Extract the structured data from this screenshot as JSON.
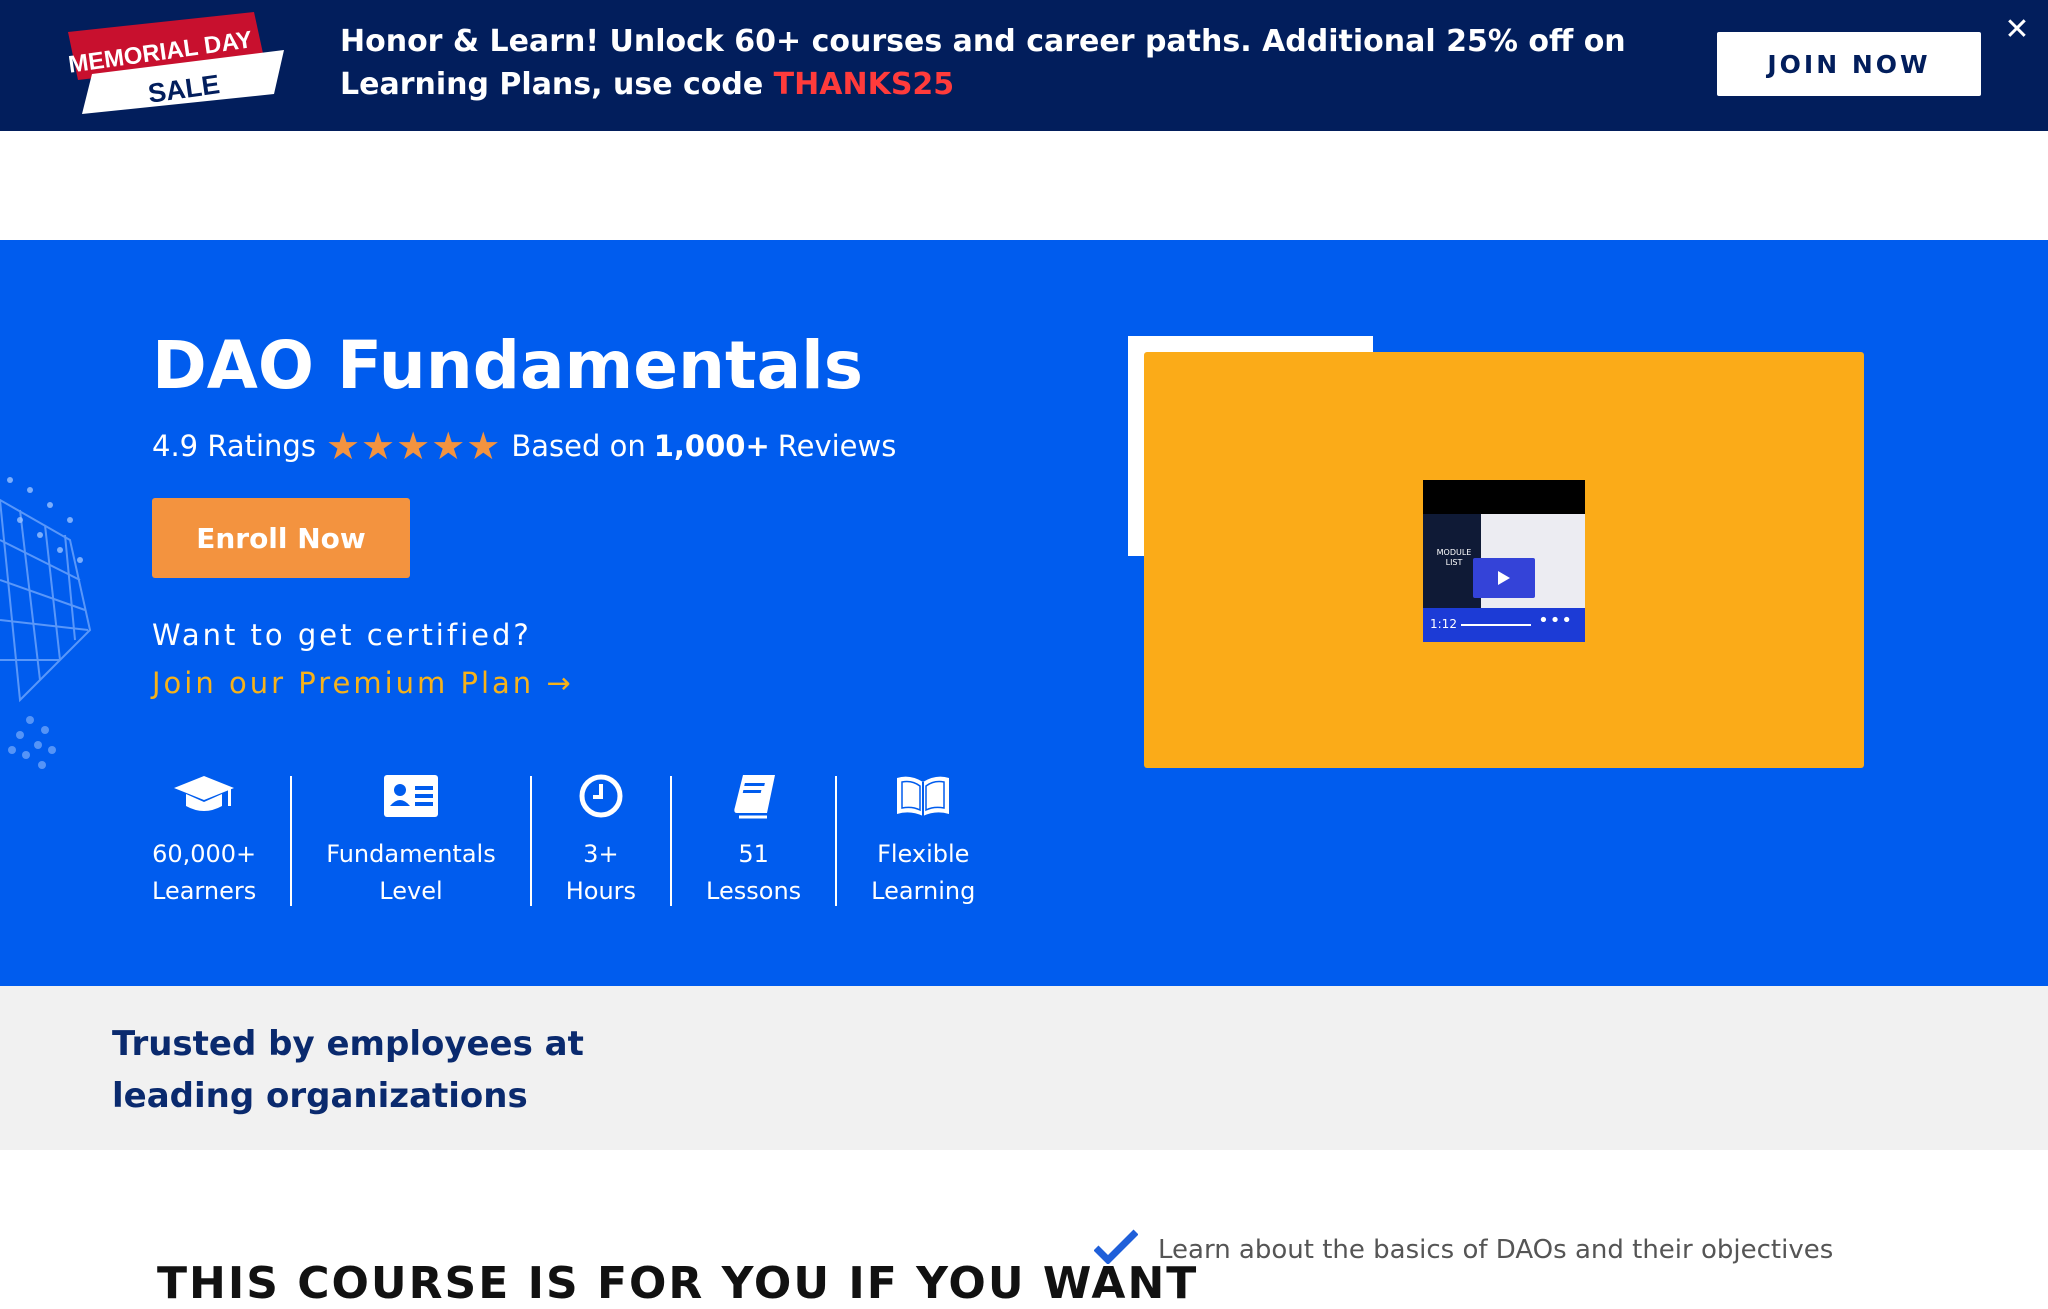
{
  "promo": {
    "badge_line1": "MEMORIAL DAY",
    "badge_line2": "SALE",
    "text": "Honor & Learn! Unlock 60+ courses and career paths. Additional 25% off on Learning Plans, use code",
    "code": "THANKS25",
    "join_label": "JOIN NOW",
    "close_glyph": "✕"
  },
  "hero": {
    "title": "DAO Fundamentals",
    "rating_value": "4.9 Ratings",
    "rating_stars": 5,
    "reviews_prefix": "Based on",
    "reviews_count": "1,000+",
    "reviews_suffix": "Reviews",
    "enroll_label": "Enroll Now",
    "cert_question": "Want to get certified?",
    "premium_link": "Join our Premium Plan →",
    "stats": [
      {
        "line1": "60,000+",
        "line2": "Learners",
        "icon": "graduation-cap-icon"
      },
      {
        "line1": "Fundamentals",
        "line2": "Level",
        "icon": "id-card-icon"
      },
      {
        "line1": "3+",
        "line2": "Hours",
        "icon": "clock-icon"
      },
      {
        "line1": "51",
        "line2": "Lessons",
        "icon": "book-icon"
      },
      {
        "line1": "Flexible",
        "line2": "Learning",
        "icon": "open-book-icon"
      }
    ],
    "video": {
      "module_label": "MODULE LIST",
      "time": "1:12",
      "menu": "•••"
    }
  },
  "trusted": {
    "title": "Trusted by employees at leading organizations"
  },
  "bottom": {
    "heading": "THIS COURSE IS FOR YOU IF YOU WANT",
    "objective_1": "Learn about the basics of DAOs and their objectives"
  },
  "colors": {
    "navy": "#021e5c",
    "hero_blue": "#005cee",
    "orange": "#f3933f",
    "gold": "#f6b21a",
    "video_bg": "#fbab18",
    "code_red": "#ff3b3b",
    "trusted_text": "#0a2a6e"
  }
}
